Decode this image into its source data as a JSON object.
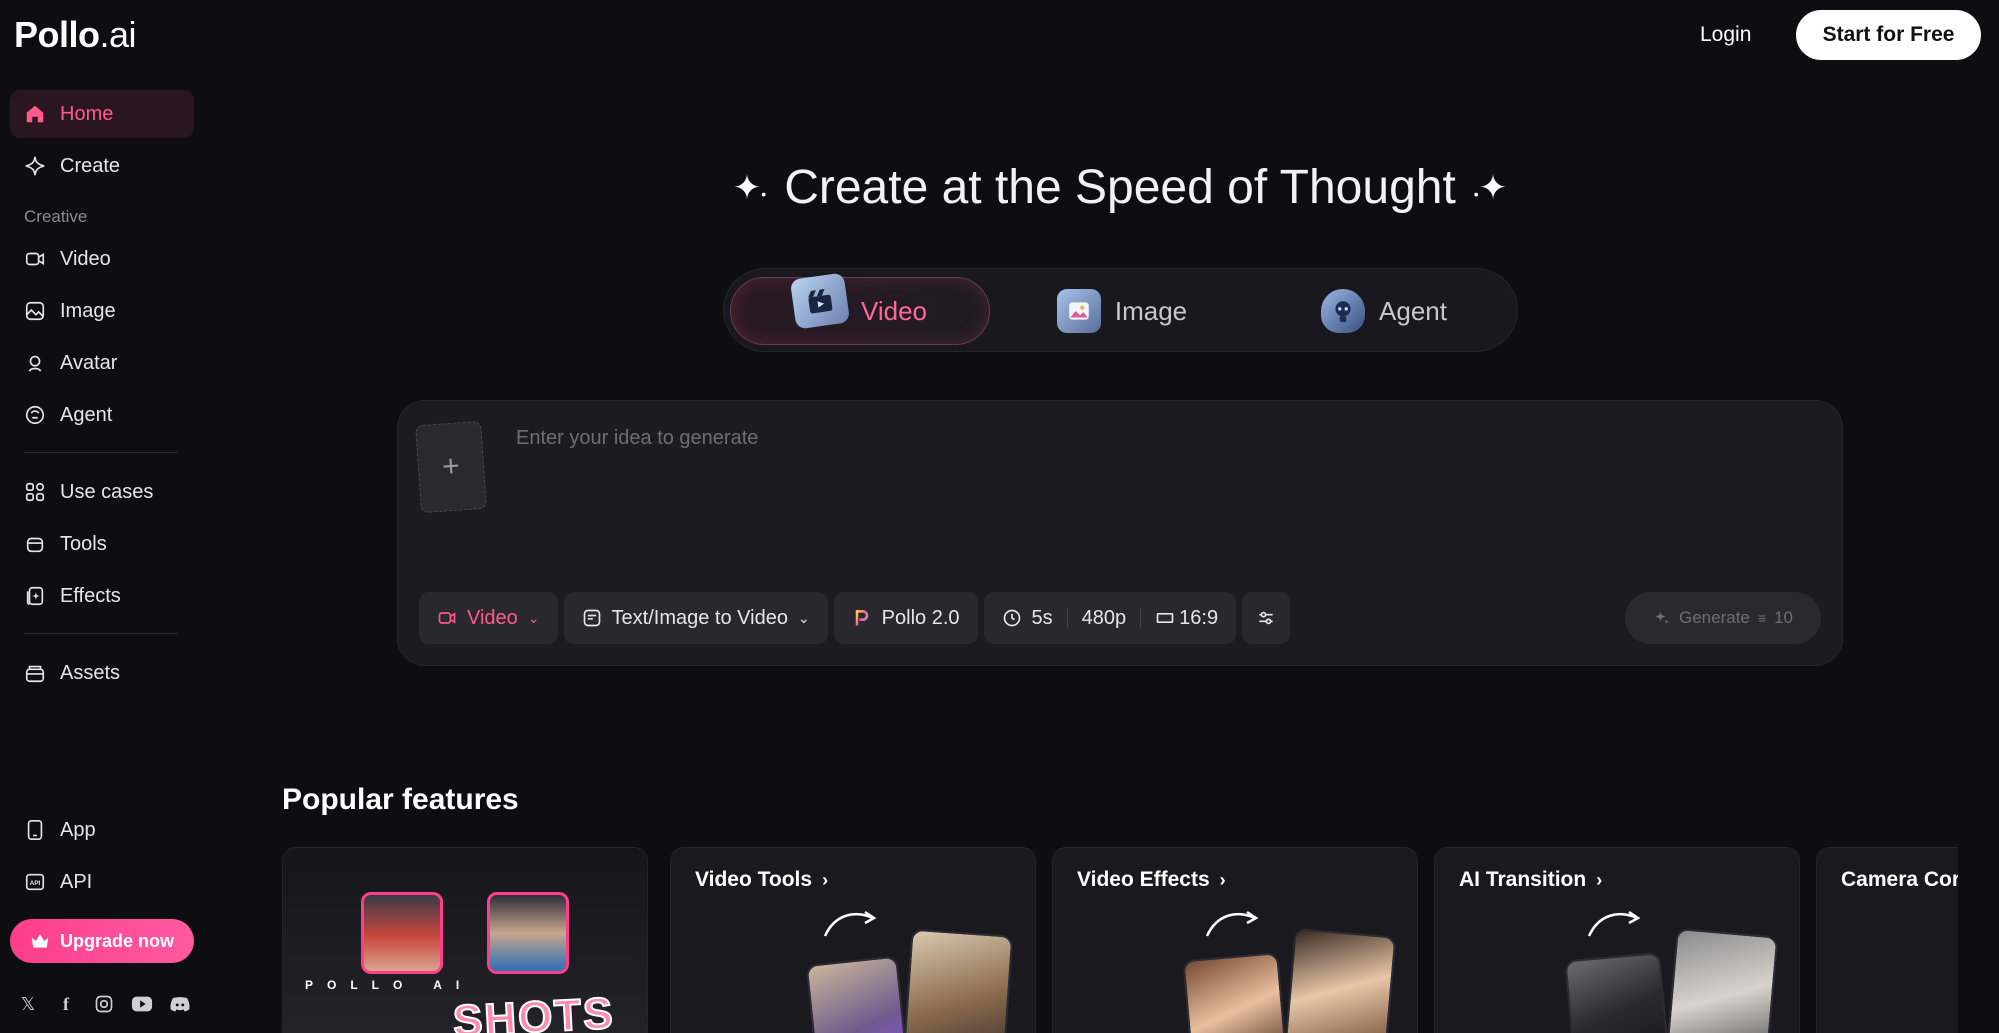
{
  "brand": {
    "name": "Pollo",
    "suffix": ".ai"
  },
  "header": {
    "login": "Login",
    "start": "Start for Free"
  },
  "sidebar": {
    "items": [
      {
        "label": "Home",
        "icon": "home-icon"
      },
      {
        "label": "Create",
        "icon": "sparkle-icon"
      },
      {
        "label": "Video",
        "icon": "video-icon"
      },
      {
        "label": "Image",
        "icon": "image-icon"
      },
      {
        "label": "Avatar",
        "icon": "avatar-icon"
      },
      {
        "label": "Agent",
        "icon": "agent-icon"
      },
      {
        "label": "Use cases",
        "icon": "grid-icon"
      },
      {
        "label": "Tools",
        "icon": "tools-icon"
      },
      {
        "label": "Effects",
        "icon": "effects-icon"
      },
      {
        "label": "Assets",
        "icon": "assets-icon"
      },
      {
        "label": "App",
        "icon": "phone-icon"
      },
      {
        "label": "API",
        "icon": "api-icon"
      }
    ],
    "section_label": "Creative",
    "upgrade": "Upgrade now",
    "socials": [
      "x-icon",
      "facebook-icon",
      "instagram-icon",
      "youtube-icon",
      "discord-icon"
    ]
  },
  "hero": {
    "title": "Create at the Speed of Thought"
  },
  "modes": [
    {
      "label": "Video",
      "active": true
    },
    {
      "label": "Image",
      "active": false
    },
    {
      "label": "Agent",
      "active": false
    }
  ],
  "prompt": {
    "placeholder": "Enter your idea to generate",
    "type": "Video",
    "mode": "Text/Image to Video",
    "model": "Pollo 2.0",
    "duration": "5s",
    "resolution": "480p",
    "ratio": "16:9",
    "generate": "Generate",
    "credits": "10"
  },
  "popular": {
    "title": "Popular features",
    "cards": [
      {
        "title": "",
        "banner_text": "POLLO AI",
        "banner_title": "SHOTS"
      },
      {
        "title": "Video Tools"
      },
      {
        "title": "Video Effects"
      },
      {
        "title": "AI Transition"
      },
      {
        "title": "Camera Cor"
      }
    ]
  },
  "colors": {
    "accent": "#ff4f86",
    "background": "#0e0d11",
    "panel": "#1c1b22"
  }
}
